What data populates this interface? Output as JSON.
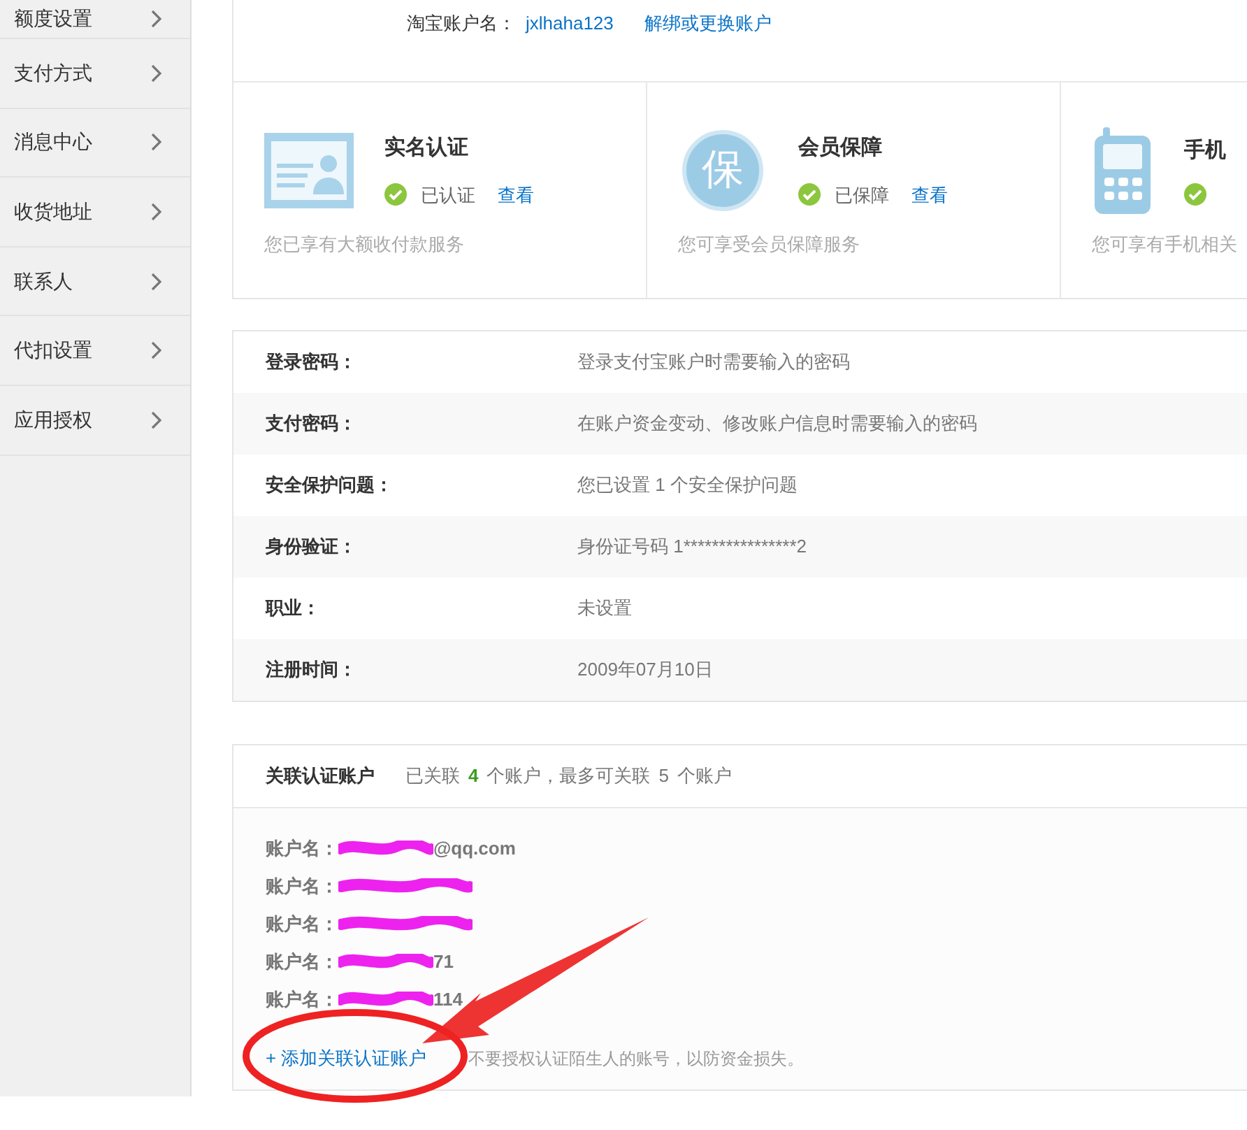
{
  "sidebar": {
    "items": [
      {
        "label": "额度设置"
      },
      {
        "label": "支付方式"
      },
      {
        "label": "消息中心"
      },
      {
        "label": "收货地址"
      },
      {
        "label": "联系人"
      },
      {
        "label": "代扣设置"
      },
      {
        "label": "应用授权"
      }
    ]
  },
  "taobao": {
    "label": "淘宝账户名：",
    "value": "jxlhaha123",
    "action": "解绑或更换账户"
  },
  "cards": [
    {
      "kind": "idcard",
      "title": "实名认证",
      "status": "已认证",
      "link": "查看",
      "desc": "您已享有大额收付款服务"
    },
    {
      "kind": "guarantee",
      "glyph": "保",
      "title": "会员保障",
      "status": "已保障",
      "link": "查看",
      "desc": "您可享受会员保障服务"
    },
    {
      "kind": "phone",
      "title": "手机",
      "desc": "您可享有手机相关"
    }
  ],
  "info": [
    {
      "label": "登录密码：",
      "value": "登录支付宝账户时需要输入的密码"
    },
    {
      "label": "支付密码：",
      "value": "在账户资金变动、修改账户信息时需要输入的密码"
    },
    {
      "label": "安全保护问题：",
      "value": "您已设置 1 个安全保护问题"
    },
    {
      "label": "身份验证：",
      "value": "身份证号码 1****************2"
    },
    {
      "label": "职业：",
      "value": "未设置"
    },
    {
      "label": "注册时间：",
      "value": "2009年07月10日"
    }
  ],
  "linked": {
    "title": "关联认证账户",
    "summary": "已关联",
    "count": "4",
    "summary_mid": "个账户，最多可关联",
    "max": "5",
    "summary_end": "个账户",
    "accounts": [
      {
        "label": "账户名：",
        "visible": "@qq.com"
      },
      {
        "label": "账户名："
      },
      {
        "label": "账户名："
      },
      {
        "label": "账户名：",
        "visible": "71"
      },
      {
        "label": "账户名：",
        "visible": "114"
      }
    ],
    "add": "+ 添加关联认证账户",
    "hint": "不要授权认证陌生人的账号，以防资金损失。"
  }
}
